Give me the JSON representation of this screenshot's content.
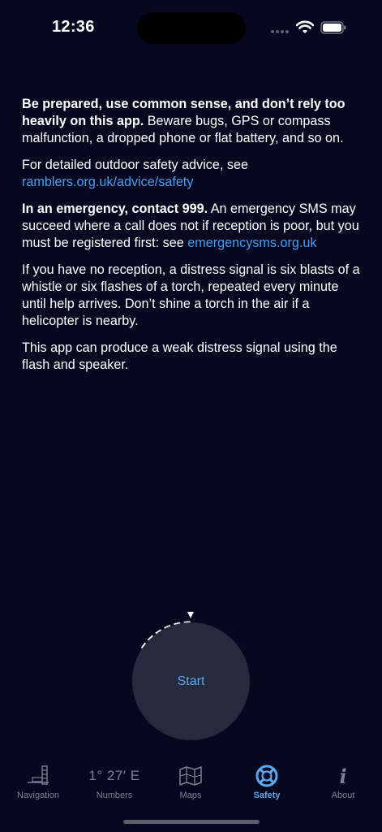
{
  "status_bar": {
    "time": "12:36"
  },
  "content": {
    "p1_bold": "Be prepared, use common sense, and don’t rely too heavily on this app.",
    "p1_rest": " Beware bugs, GPS or compass malfunction, a dropped phone or flat battery, and so on.",
    "p2_text": "For detailed outdoor safety advice, see ",
    "p2_link": "ramblers.org.uk/advice/safety",
    "p3_bold": "In an emergency, contact 999.",
    "p3_rest": " An emergency SMS may succeed where a call does not if reception is poor, but you must be registered first: see ",
    "p3_link": "emergencysms.org.uk",
    "p4": "If you have no reception, a distress signal is six blasts of a whistle or six flashes of a torch, repeated every minute until help arrives. Don’t shine a torch in the air if a helicopter is nearby.",
    "p5": "This app can produce a weak distress signal using the flash and speaker."
  },
  "start_button": {
    "label": "Start"
  },
  "tabs": [
    {
      "label": "Navigation",
      "icon": "navigation-icon"
    },
    {
      "label": "Numbers",
      "icon": "coordinates-text",
      "icon_text": "1° 27′ E"
    },
    {
      "label": "Maps",
      "icon": "map-icon"
    },
    {
      "label": "Safety",
      "icon": "lifebuoy-icon",
      "active": true
    },
    {
      "label": "About",
      "icon": "info-icon",
      "icon_text": "i"
    }
  ],
  "colors": {
    "background": "#05081f",
    "accent": "#4a9ef0",
    "inactive": "#7c8090",
    "button": "#262a3d"
  }
}
